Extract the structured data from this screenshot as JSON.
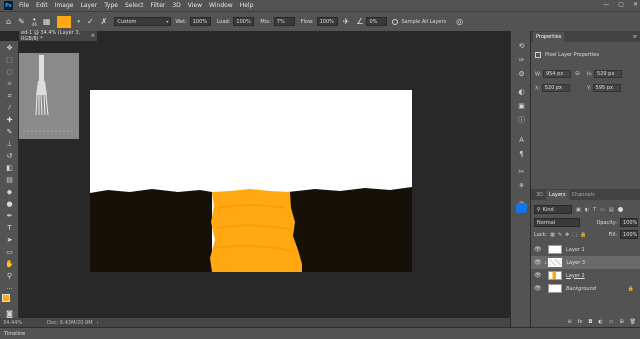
{
  "app": {
    "logo": "Ps"
  },
  "menu": [
    "File",
    "Edit",
    "Image",
    "Layer",
    "Type",
    "Select",
    "Filter",
    "3D",
    "View",
    "Window",
    "Help"
  ],
  "window_controls": [
    "—",
    "▢",
    "✕"
  ],
  "options": {
    "brush_size": "46",
    "mode": "Custom",
    "wet_label": "Wet:",
    "wet_value": "100%",
    "load_label": "Load:",
    "load_value": "100%",
    "mix_label": "Mix:",
    "mix_value": "7%",
    "flow_label": "Flow:",
    "flow_value": "100%",
    "angle_value": "0%",
    "sample_all_label": "Sample All Layers",
    "colors": {
      "swatch": "#ffa812"
    }
  },
  "doc_tab": {
    "title": "ed-1 @ 34.4% (Layer 3, RGB/8) *",
    "close": "×"
  },
  "status": {
    "zoom": "34.44%",
    "doc": "Doc: 6.43M/20.9M"
  },
  "timeline": {
    "label": "Timeline"
  },
  "properties": {
    "tab_label": "Properties",
    "subtitle": "Pixel Layer Properties",
    "w_label": "W:",
    "w_value": "954 px",
    "h_label": "H:",
    "h_value": "529 px",
    "x_label": "X:",
    "x_value": "520 px",
    "y_label": "Y:",
    "y_value": "595 px"
  },
  "layers_panel": {
    "tabs": [
      "3D",
      "Layers",
      "Channels"
    ],
    "filter_kind": "Kind",
    "blend_mode": "Normal",
    "opacity_label": "Opacity:",
    "opacity_value": "100%",
    "lock_label": "Lock:",
    "fill_label": "Fill:",
    "fill_value": "100%",
    "layers": [
      {
        "name": "Layer 1"
      },
      {
        "name": "Layer 3"
      },
      {
        "name": "Layer 2"
      },
      {
        "name": "Background"
      }
    ]
  }
}
